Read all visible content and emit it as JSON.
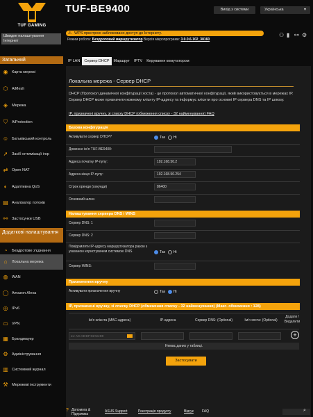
{
  "header": {
    "logo_text": "TUF GAMING",
    "model": "TUF-BE9400",
    "logout_label": "Вихід з системи",
    "language": "Українська",
    "banner": "WPS пристрою заблоковано доступ до Інтернету.",
    "opmode_label": "Режим роботи:",
    "opmode_value": "Бездротовий маршрутизатор",
    "firmware_label": "Версія мікропрограми:",
    "firmware_value": "3.0.0.6.102_38160"
  },
  "sidebar": {
    "qis": "Швидке налаштування Інтернет",
    "general": "Загальний",
    "advanced": "Додаткові налаштування",
    "items": [
      {
        "label": "Карта мережі",
        "icon": "map-icon"
      },
      {
        "label": "AiMesh",
        "icon": "aimesh-icon"
      },
      {
        "label": "Мережа",
        "icon": "network-icon"
      },
      {
        "label": "AiProtection",
        "icon": "shield-icon"
      },
      {
        "label": "Батьківський контроль",
        "icon": "parental-icon"
      },
      {
        "label": "Засіб оптимізації ігор",
        "icon": "rocket-icon"
      },
      {
        "label": "Open NAT",
        "icon": "nat-icon"
      },
      {
        "label": "Адаптивна QoS",
        "icon": "qos-icon"
      },
      {
        "label": "Аналізатор потоків",
        "icon": "traffic-icon"
      },
      {
        "label": "Застосунки USB",
        "icon": "usb-icon"
      },
      {
        "label": "Бездротове з'єднання",
        "icon": "wifi-icon"
      },
      {
        "label": "Локальна мережа",
        "icon": "home-icon"
      },
      {
        "label": "WAN",
        "icon": "globe-icon"
      },
      {
        "label": "Amazon Alexa",
        "icon": "alexa-icon"
      },
      {
        "label": "IPv6",
        "icon": "ipv6-icon"
      },
      {
        "label": "VPN",
        "icon": "vpn-icon"
      },
      {
        "label": "Брандмауер",
        "icon": "firewall-icon"
      },
      {
        "label": "Адміністрування",
        "icon": "admin-icon"
      },
      {
        "label": "Системний журнал",
        "icon": "log-icon"
      },
      {
        "label": "Мережеві інструменти",
        "icon": "tools-icon"
      }
    ]
  },
  "tabs": [
    "IP LAN",
    "Сервер DHCP",
    "Маршрут",
    "IPTV",
    "Керування комутатором"
  ],
  "page": {
    "title": "Локальна мережа - Сервер DHCP",
    "description": "DHCP (Протокол динамічної конфігурації хоста) - це протокол автоматичної конфігурації, який використовується в мережах IP. Сервер DHCP може призначити кожному клієнту IP-адресу та інформує клієнти про основні IP сервера DNS та IP шлюзу.",
    "note": "IP, призначені вручну, зі списку DHCP (обмеження списку - 32 найменування) FAQ",
    "basic": {
      "header": "Базова конфігурація",
      "enable_label": "Активувати сервер DHCP?",
      "yes": "Так",
      "no": "Ні",
      "domain_label": "Доменне ім'я TUF-BE9400:",
      "domain_value": "",
      "start_label": "Адреса початку IP-пулу:",
      "start_value": "192.168.50.2",
      "end_label": "Адреса кінця IP-пулу:",
      "end_value": "192.168.50.254",
      "lease_label": "Строк оренди (секунди)",
      "lease_value": "86400",
      "gateway_label": "Основний шлюз",
      "gateway_value": ""
    },
    "dns": {
      "header": "Налаштування сервера DNS і WINS",
      "dns1_label": "Сервер DNS: 1",
      "dns2_label": "Сервер DNS: 2",
      "advertise_label": "Повідомляти IP-адресу маршрутизатора разом з указаною користувачем системою DNS",
      "wins_label": "Сервер WINS:"
    },
    "manual": {
      "header": "Призначення вручну",
      "enable_label": "Активувати призначення вручну"
    },
    "list": {
      "header": "IP, призначені вручну, зі списку DHCP (обмеження списку - 32 найменування) (Макс. обмеження : 128)",
      "col_mac": "Ім'я клієнта (MAC-адреса)",
      "col_ip": "IP-адреса",
      "col_dns": "Сервер DNS: (Optional)",
      "col_host": "Ім'я хоста: (Optional)",
      "col_add": "Додати / Видалити",
      "mac_placeholder": "ex: AC:AD:EF:02:51:D0",
      "no_data": "Немає даних у таблиці.",
      "apply": "Застосувати"
    }
  },
  "footer": {
    "help": "Допомога & Підтримка",
    "asus_support": "ASUS Support",
    "product_reg": "Реєстрація продукту",
    "feedback": "Відгук",
    "faq": "FAQ"
  },
  "colors": {
    "accent": "#f4a30c",
    "background": "#0c0c0c",
    "panel": "#1b1b1b"
  }
}
